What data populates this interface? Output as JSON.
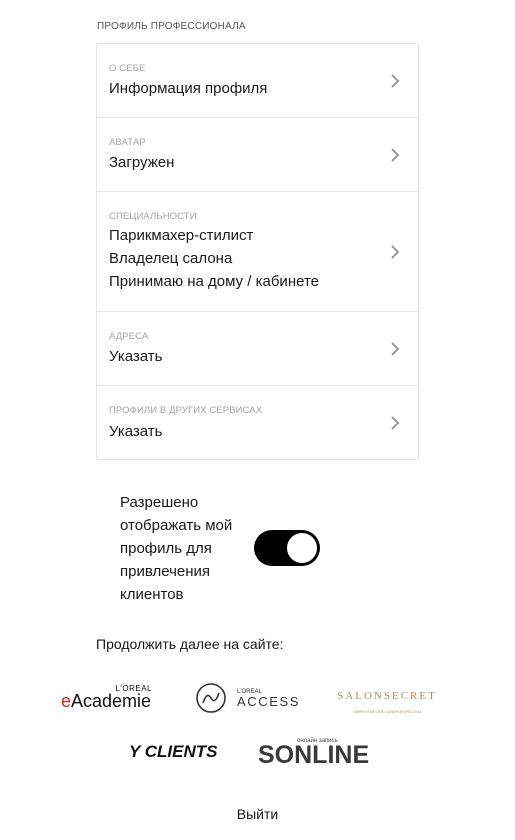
{
  "section_title": "ПРОФИЛЬ ПРОФЕССИОНАЛА",
  "profile_rows": [
    {
      "label": "О СЕБЕ",
      "lines": [
        "Информация профиля"
      ]
    },
    {
      "label": "АВАТАР",
      "lines": [
        "Загружен"
      ]
    },
    {
      "label": "СПЕЦИАЛЬНОСТИ",
      "lines": [
        "Парикмахер-стилист",
        "Владелец салона",
        "Принимаю на дому / кабинете"
      ]
    },
    {
      "label": "АДРЕСА",
      "lines": [
        "Указать"
      ]
    },
    {
      "label": "ПРОФИЛИ В ДРУГИХ СЕРВИСАХ",
      "lines": [
        "Указать"
      ]
    }
  ],
  "consent": {
    "text": "Разрешено отображать мой профиль для привлечения клиентов",
    "enabled": true
  },
  "continue_label": "Продолжить далее на сайте:",
  "logos": {
    "eacademie": {
      "brand": "L'OREAL",
      "name": "eAcademie",
      "accent": "#e2231a"
    },
    "access": {
      "brand": "L'OREAL",
      "name": "ACCESS"
    },
    "salon_secret": {
      "name": "SALONSECRET",
      "sub": "СЕКРЕТНАЯ СЕТЬ САЛОНОВ КРАСОТЫ",
      "color": "#b08d64"
    },
    "yclients": {
      "name": "Y CLIENTS"
    },
    "sonline": {
      "name": "SONLINE",
      "over": "онлайн запись"
    }
  },
  "logout_label": "Выйти"
}
